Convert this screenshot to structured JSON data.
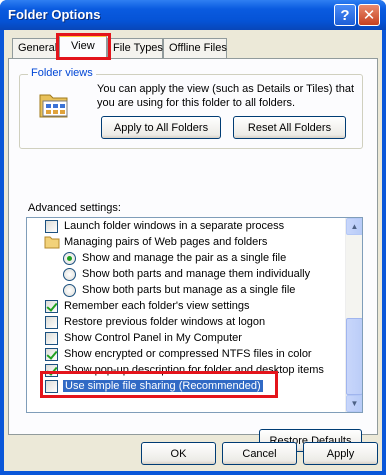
{
  "window": {
    "title": "Folder Options",
    "help_glyph": "?",
    "close_glyph": "✕"
  },
  "tabs": [
    {
      "label": "General"
    },
    {
      "label": "View"
    },
    {
      "label": "File Types"
    },
    {
      "label": "Offline Files"
    }
  ],
  "folder_views": {
    "heading": "Folder views",
    "description": "You can apply the view (such as Details or Tiles) that you are using for this folder to all folders.",
    "apply_label": "Apply to All Folders",
    "reset_label": "Reset All Folders"
  },
  "advanced": {
    "heading": "Advanced settings:",
    "items": [
      {
        "kind": "checkbox",
        "label": "Launch folder windows in a separate process",
        "checked": false
      },
      {
        "kind": "folder",
        "label": "Managing pairs of Web pages and folders"
      },
      {
        "kind": "radio",
        "label": "Show and manage the pair as a single file",
        "checked": true
      },
      {
        "kind": "radio",
        "label": "Show both parts and manage them individually",
        "checked": false
      },
      {
        "kind": "radio",
        "label": "Show both parts but manage as a single file",
        "checked": false
      },
      {
        "kind": "checkbox",
        "label": "Remember each folder's view settings",
        "checked": true
      },
      {
        "kind": "checkbox",
        "label": "Restore previous folder windows at logon",
        "checked": false
      },
      {
        "kind": "checkbox",
        "label": "Show Control Panel in My Computer",
        "checked": false
      },
      {
        "kind": "checkbox",
        "label": "Show encrypted or compressed NTFS files in color",
        "checked": true
      },
      {
        "kind": "checkbox",
        "label": "Show pop-up description for folder and desktop items",
        "checked": true
      },
      {
        "kind": "checkbox",
        "label": "Use simple file sharing (Recommended)",
        "checked": false,
        "selected": true
      }
    ],
    "restore_label": "Restore Defaults"
  },
  "footer": {
    "ok_label": "OK",
    "cancel_label": "Cancel",
    "apply_label": "Apply"
  },
  "colors": {
    "highlight": "#e3141b",
    "selection": "#316ac5",
    "title_bar": "#0553d6",
    "check": "#21a121"
  }
}
